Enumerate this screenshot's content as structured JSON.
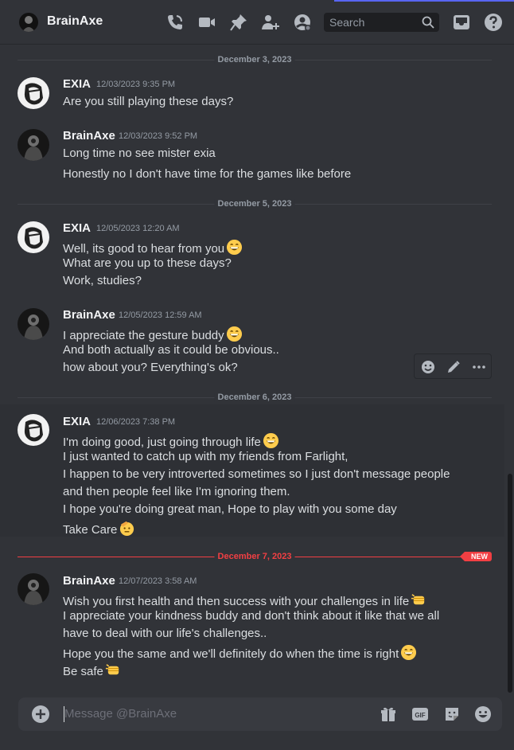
{
  "header": {
    "title": "BrainAxe",
    "search_placeholder": "Search",
    "icons": [
      "phone-call-icon",
      "video-camera-icon",
      "pin-icon",
      "add-friend-icon",
      "user-profile-icon",
      "inbox-icon",
      "help-icon"
    ]
  },
  "dividers": [
    {
      "label": "December 3, 2023"
    },
    {
      "label": "December 5, 2023"
    },
    {
      "label": "December 6, 2023"
    },
    {
      "label": "December 7, 2023",
      "badge": "NEW"
    }
  ],
  "messages": [
    {
      "author": "EXIA",
      "timestamp": "12/03/2023 9:35 PM",
      "lines": [
        "Are you still playing these days?"
      ]
    },
    {
      "author": "BrainAxe",
      "timestamp": "12/03/2023 9:52 PM",
      "lines": [
        "Long time no see mister exia",
        "Honestly no I don't have time for the games like before"
      ]
    },
    {
      "author": "EXIA",
      "timestamp": "12/05/2023 12:20 AM",
      "lines": [
        "Well, its good to hear from you",
        "What are you up to these days?",
        "Work, studies?"
      ]
    },
    {
      "author": "BrainAxe",
      "timestamp": "12/05/2023 12:59 AM",
      "lines": [
        "I appreciate the gesture buddy",
        "And both actually as it could be obvious..",
        "how about you? Everything's ok?"
      ]
    },
    {
      "author": "EXIA",
      "timestamp": "12/06/2023 7:38 PM",
      "lines": [
        "I'm doing good, just going through life",
        "I just wanted to catch up with my friends from Farlight,",
        "I happen to be very introverted sometimes so I just don't message people",
        "and then people feel like I'm ignoring them.",
        "I hope you're doing great man, Hope to play with you some day",
        "Take Care"
      ]
    },
    {
      "author": "BrainAxe",
      "timestamp": "12/07/2023 3:58 AM",
      "lines": [
        "Wish you first health and then success with your challenges in life",
        "I appreciate your kindness buddy and don't think about it like that we all",
        "have to deal with our life's challenges..",
        "Hope you the same and we'll definitely do when the time is right",
        "Be safe"
      ]
    }
  ],
  "composer": {
    "placeholder": "Message @BrainAxe",
    "gif_label": "GIF"
  },
  "colors": {
    "accent": "#5865f2",
    "new": "#f23f43",
    "background": "#313338"
  }
}
